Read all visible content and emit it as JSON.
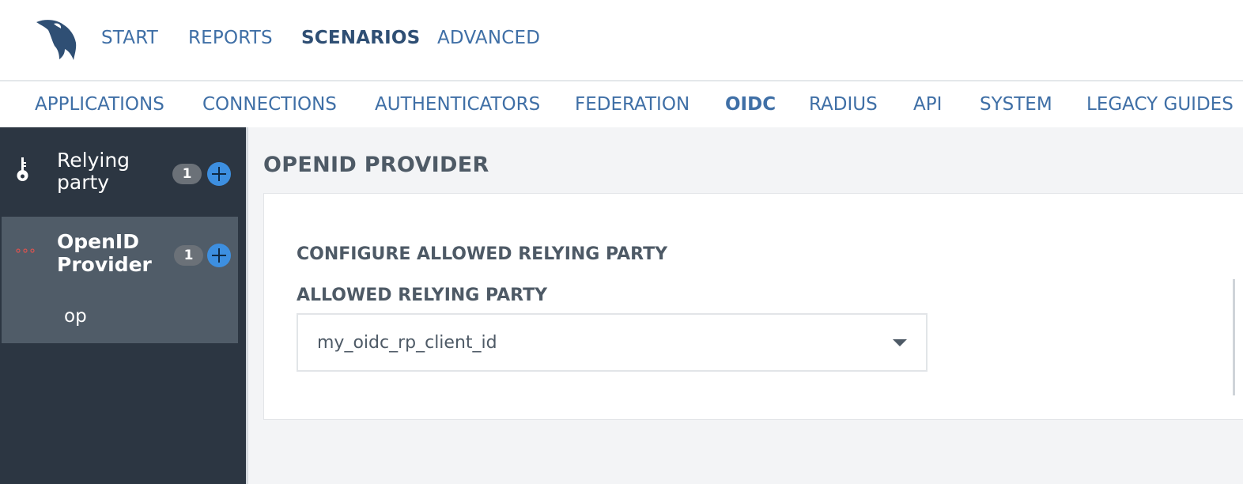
{
  "topnav": {
    "items": [
      {
        "label": "START",
        "active": false
      },
      {
        "label": "REPORTS",
        "active": false
      },
      {
        "label": "SCENARIOS",
        "active": true
      },
      {
        "label": "ADVANCED",
        "active": false
      }
    ]
  },
  "subnav": {
    "items": [
      {
        "label": "APPLICATIONS",
        "active": false
      },
      {
        "label": "CONNECTIONS",
        "active": false
      },
      {
        "label": "AUTHENTICATORS",
        "active": false
      },
      {
        "label": "FEDERATION",
        "active": false
      },
      {
        "label": "OIDC",
        "active": true
      },
      {
        "label": "RADIUS",
        "active": false
      },
      {
        "label": "API",
        "active": false
      },
      {
        "label": "SYSTEM",
        "active": false
      },
      {
        "label": "LEGACY GUIDES",
        "active": false
      }
    ]
  },
  "sidebar": {
    "items": [
      {
        "label_line1": "Relying",
        "label_line2": "party",
        "count": "1",
        "icon": "key-icon",
        "selected": false
      },
      {
        "label_line1": "OpenID",
        "label_line2": "Provider",
        "count": "1",
        "icon": "dots-icon",
        "selected": true,
        "children": [
          "op"
        ]
      }
    ]
  },
  "main": {
    "title": "OPENID PROVIDER",
    "section_title": "CONFIGURE ALLOWED RELYING PARTY",
    "field_label": "ALLOWED RELYING PARTY",
    "select_value": "my_oidc_rp_client_id"
  },
  "colors": {
    "nav_link": "#3f6fa6",
    "nav_active": "#2f4f74",
    "sidebar_bg": "#2c3642",
    "sidebar_selected": "#505c68",
    "add_button": "#3d8fe0",
    "main_bg": "#f3f4f6",
    "heading_text": "#4e5a66",
    "dots_icon": "#d9534f"
  }
}
